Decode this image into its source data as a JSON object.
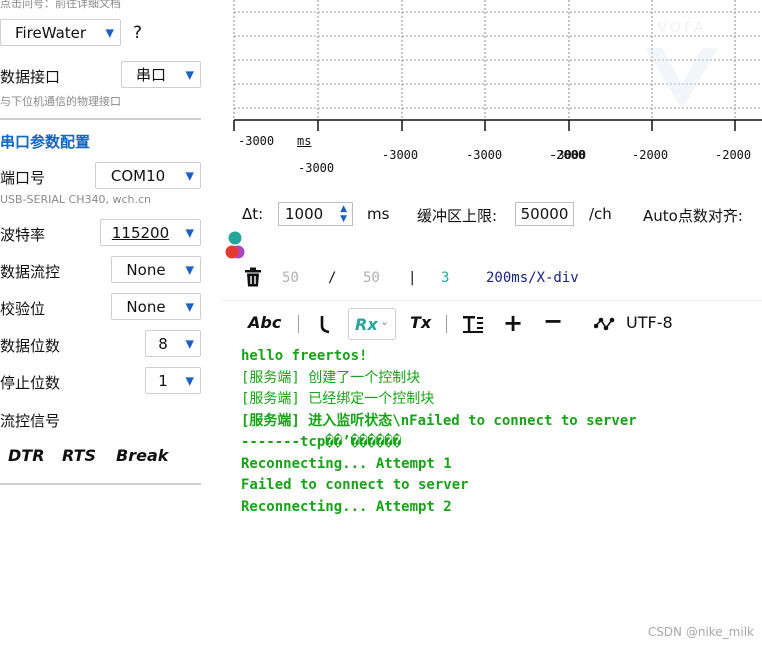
{
  "sidebar": {
    "top_hint": "点击问号：前往详细文档",
    "protocol": {
      "value": "FireWater",
      "help": "?"
    },
    "data_interface": {
      "label": "数据接口",
      "value": "串口",
      "hint": "与下位机通信的物理接口"
    },
    "section_title": "串口参数配置",
    "port": {
      "label": "端口号",
      "value": "COM10",
      "hint": "USB-SERIAL CH340, wch.cn"
    },
    "baud": {
      "label": "波特率",
      "value": "115200"
    },
    "flow": {
      "label": "数据流控",
      "value": "None"
    },
    "parity": {
      "label": "校验位",
      "value": "None"
    },
    "data_bits": {
      "label": "数据位数",
      "value": "8"
    },
    "stop_bits": {
      "label": "停止位数",
      "value": "1"
    },
    "flow_signal": {
      "label": "流控信号",
      "buttons": [
        "DTR",
        "RTS",
        "Break"
      ]
    }
  },
  "plot": {
    "x_ticks": [
      "-3000",
      "-3000",
      "-3000",
      "-3000",
      "-2000",
      "-2000",
      "-2000"
    ],
    "x_unit": "ms",
    "x_sub": "-3000"
  },
  "controls": {
    "dt_label": "Δt:",
    "dt_value": "1000",
    "dt_unit": "ms",
    "buffer_label": "缓冲区上限:",
    "buffer_value": "50000",
    "buffer_unit": "/ch",
    "auto_align_label": "Auto点数对齐:",
    "count_a": "50",
    "count_sep": "/",
    "count_b": "50",
    "bar": "|",
    "channels": "3",
    "div": "200ms/X-div"
  },
  "toolbar": {
    "abc": "Abc",
    "rx": "Rx",
    "tx": "Tx",
    "encoding": "UTF-8"
  },
  "console": {
    "lines": [
      {
        "text": "hello freertos!",
        "bold": true
      },
      {
        "text": "[服务端] 创建了一个控制块",
        "bold": false
      },
      {
        "text": "[服务端] 已经绑定一个控制块",
        "bold": false
      },
      {
        "text": "[服务端] 进入监听状态\\nFailed to connect to server",
        "bold": true
      },
      {
        "text": "-------tcp��’������",
        "bold": true
      },
      {
        "text": "Reconnecting... Attempt 1",
        "bold": true
      },
      {
        "text": "Failed to connect to server",
        "bold": true
      },
      {
        "text": "Reconnecting... Attempt 2",
        "bold": true
      }
    ]
  },
  "watermark_text": "CSDN @nike_milk",
  "colors": {
    "accent": "#1565c0",
    "console_text": "#17a317",
    "count_gray": "#b0b0b0",
    "channel_teal": "#26a69a",
    "dot_teal": "#26a69a",
    "dot_red": "#e53935",
    "dot_purple": "#ab47bc"
  }
}
